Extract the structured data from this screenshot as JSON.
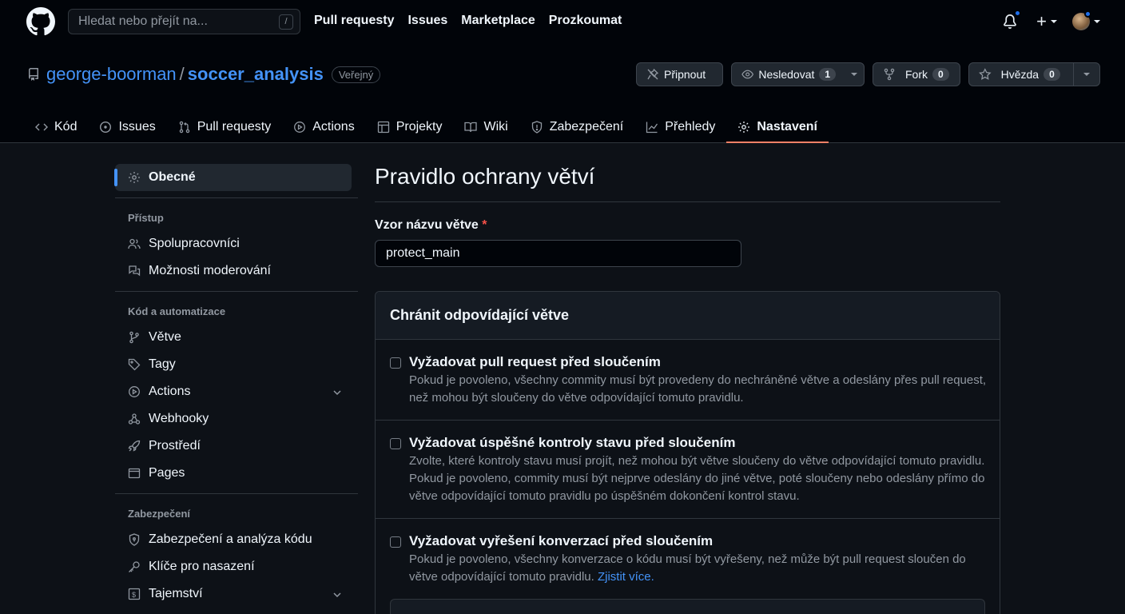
{
  "header": {
    "search_placeholder": "Hledat nebo přejít na...",
    "search_shortcut": "/",
    "nav": [
      "Pull requesty",
      "Issues",
      "Marketplace",
      "Prozkoumat"
    ]
  },
  "repo": {
    "owner": "george-boorman",
    "separator": "/",
    "name": "soccer_analysis",
    "visibility": "Veřejný",
    "pin_label": "Připnout",
    "watch_label": "Nesledovat",
    "watch_count": "1",
    "fork_label": "Fork",
    "fork_count": "0",
    "star_label": "Hvězda",
    "star_count": "0"
  },
  "tabs": [
    {
      "label": "Kód",
      "icon": "code-icon"
    },
    {
      "label": "Issues",
      "icon": "issue-icon"
    },
    {
      "label": "Pull requesty",
      "icon": "pull-request-icon"
    },
    {
      "label": "Actions",
      "icon": "play-icon"
    },
    {
      "label": "Projekty",
      "icon": "table-icon"
    },
    {
      "label": "Wiki",
      "icon": "book-icon"
    },
    {
      "label": "Zabezpečení",
      "icon": "shield-icon"
    },
    {
      "label": "Přehledy",
      "icon": "graph-icon"
    },
    {
      "label": "Nastavení",
      "icon": "gear-icon",
      "active": true
    }
  ],
  "sidebar": {
    "general": "Obecné",
    "access_heading": "Přístup",
    "access_items": [
      "Spolupracovníci",
      "Možnosti moderování"
    ],
    "code_heading": "Kód a automatizace",
    "code_items": [
      "Větve",
      "Tagy",
      "Actions",
      "Webhooky",
      "Prostředí",
      "Pages"
    ],
    "security_heading": "Zabezpečení",
    "security_items": [
      "Zabezpečení a analýza kódu",
      "Klíče pro nasazení",
      "Tajemství"
    ]
  },
  "main": {
    "title": "Pravidlo ochrany větví",
    "pattern_label": "Vzor názvu větve",
    "required_mark": "*",
    "pattern_value": "protect_main",
    "box_heading": "Chránit odpovídající větve",
    "options": [
      {
        "title": "Vyžadovat pull request před sloučením",
        "desc": "Pokud je povoleno, všechny commity musí být provedeny do nechráněné větve a odeslány přes pull request, než mohou být sloučeny do větve odpovídající tomuto pravidlu."
      },
      {
        "title": "Vyžadovat úspěšné kontroly stavu před sloučením",
        "desc": "Zvolte, které kontroly stavu musí projít, než mohou být větve sloučeny do větve odpovídající tomuto pravidlu. Pokud je povoleno, commity musí být nejprve odeslány do jiné větve, poté sloučeny nebo odeslány přímo do větve odpovídající tomuto pravidlu po úspěšném dokončení kontrol stavu."
      },
      {
        "title": "Vyžadovat vyřešení konverzací před sloučením",
        "desc": "Pokud je povoleno, všechny konverzace o kódu musí být vyřešeny, než může být pull request sloučen do větve odpovídající tomuto pravidlu.",
        "link": "Zjistit více."
      }
    ]
  }
}
